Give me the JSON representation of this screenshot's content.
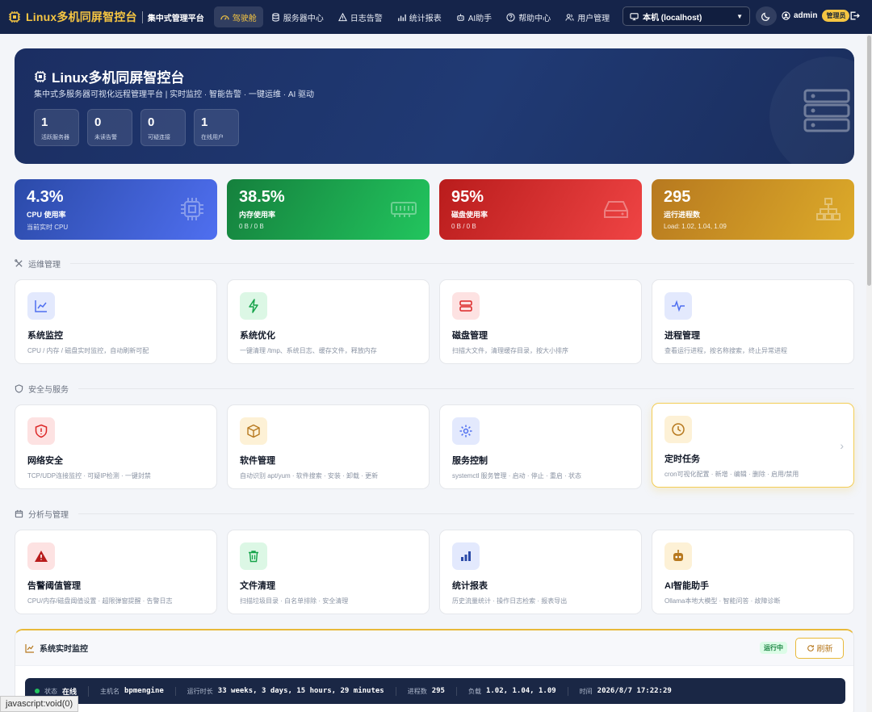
{
  "navbar": {
    "brand_title": "Linux多机同屏智控台",
    "brand_sub": "集中式管理平台",
    "items": [
      {
        "label": "驾驶舱",
        "icon": "dashboard-icon",
        "active": true
      },
      {
        "label": "服务器中心",
        "icon": "server-icon"
      },
      {
        "label": "日志告警",
        "icon": "warning-icon"
      },
      {
        "label": "统计报表",
        "icon": "bar-chart-icon"
      },
      {
        "label": "AI助手",
        "icon": "robot-icon"
      },
      {
        "label": "帮助中心",
        "icon": "question-icon"
      },
      {
        "label": "用户管理",
        "icon": "users-icon"
      }
    ],
    "host_select": "本机 (localhost)",
    "username": "admin",
    "role": "管理员"
  },
  "hero": {
    "title": "Linux多机同屏智控台",
    "subtitle": "集中式多服务器可视化远程管理平台 | 实时监控 · 智能告警 · 一键运维 · AI 驱动",
    "stats": [
      {
        "value": "1",
        "label": "活跃服务器"
      },
      {
        "value": "0",
        "label": "未读告警"
      },
      {
        "value": "0",
        "label": "可疑连接"
      },
      {
        "value": "1",
        "label": "在线用户"
      }
    ]
  },
  "metrics": [
    {
      "value": "4.3%",
      "title": "CPU 使用率",
      "sub": "当前实时 CPU",
      "icon": "cpu-icon"
    },
    {
      "value": "38.5%",
      "title": "内存使用率",
      "sub": "0 B / 0 B",
      "icon": "memory-icon"
    },
    {
      "value": "95%",
      "title": "磁盘使用率",
      "sub": "0 B / 0 B",
      "icon": "disk-icon"
    },
    {
      "value": "295",
      "title": "运行进程数",
      "sub": "Load: 1.02, 1.04, 1.09",
      "icon": "sitemap-icon"
    }
  ],
  "sections": [
    {
      "title": "运维管理",
      "cards": [
        {
          "title": "系统监控",
          "desc": "CPU / 内存 / 磁盘实时监控，自动刷新可配"
        },
        {
          "title": "系统优化",
          "desc": "一键清理 /tmp、系统日志、缓存文件，释放内存"
        },
        {
          "title": "磁盘管理",
          "desc": "扫描大文件，清理缓存目录，按大小排序"
        },
        {
          "title": "进程管理",
          "desc": "查看运行进程，按名称搜索，终止异常进程"
        }
      ]
    },
    {
      "title": "安全与服务",
      "cards": [
        {
          "title": "网络安全",
          "desc": "TCP/UDP连接监控 · 可疑IP检测 · 一键封禁"
        },
        {
          "title": "软件管理",
          "desc": "自动识别 apt/yum · 软件搜索 · 安装 · 卸载 · 更新"
        },
        {
          "title": "服务控制",
          "desc": "systemctl 服务管理 · 启动 · 停止 · 重启 · 状态"
        },
        {
          "title": "定时任务",
          "desc": "cron可视化配置 · 新增 · 编辑 · 删除 · 启用/禁用"
        }
      ]
    },
    {
      "title": "分析与管理",
      "cards": [
        {
          "title": "告警阈值管理",
          "desc": "CPU/内存/磁盘阈值设置 · 超限弹窗提醒 · 告警日志"
        },
        {
          "title": "文件清理",
          "desc": "扫描垃圾目录 · 白名单排除 · 安全清理"
        },
        {
          "title": "统计报表",
          "desc": "历史流量统计 · 操作日志检索 · 报表导出"
        },
        {
          "title": "AI智能助手",
          "desc": "Ollama本地大模型 · 智能问答 · 故障诊断"
        }
      ]
    }
  ],
  "monitor": {
    "title": "系统实时监控",
    "badge": "运行中",
    "refresh": "刷新",
    "status_label": "状态",
    "status_value": "在线",
    "host_label": "主机名",
    "host_value": "bpmengine",
    "uptime_label": "运行时长",
    "uptime_value": "33 weeks, 3 days, 15 hours, 29 minutes",
    "proc_label": "进程数",
    "proc_value": "295",
    "load_label": "负载",
    "load_value": "1.02, 1.04, 1.09",
    "time_label": "时间",
    "time_value": "2026/8/7 17:22:29"
  },
  "status_url": "javascript:void(0)",
  "colors": {
    "navbar": "#15244a",
    "accent": "#f5c542",
    "cpu": "#4f6ff0",
    "memory": "#22c55e",
    "disk": "#ef4444",
    "process": "#ddab2a"
  }
}
